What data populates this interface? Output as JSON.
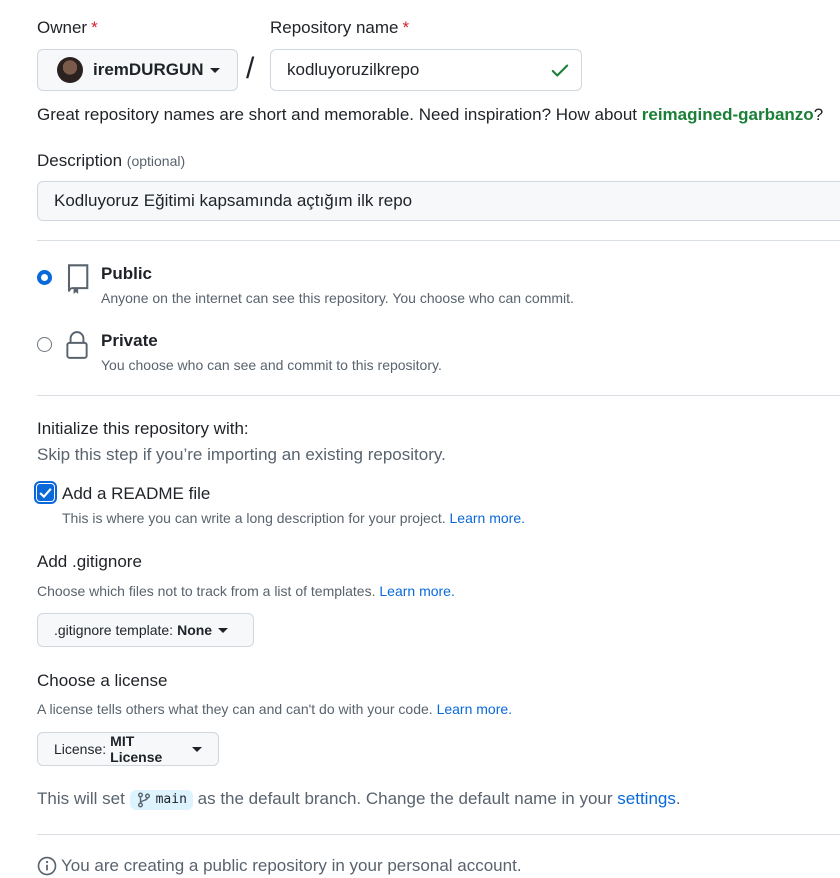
{
  "owner": {
    "label": "Owner",
    "required_mark": "*",
    "name": "iremDURGUN"
  },
  "separator": "/",
  "repository_name": {
    "label": "Repository name",
    "required_mark": "*",
    "value": "kodluyoruzilkrepo"
  },
  "name_hint": {
    "text": "Great repository names are short and memorable. Need inspiration? How about",
    "suggestion": "reimagined-garbanzo",
    "end": "?"
  },
  "description": {
    "label": "Description",
    "optional": "(optional)",
    "value": "Kodluyoruz Eğitimi kapsamında açtığım ilk repo"
  },
  "visibility": {
    "public": {
      "title": "Public",
      "subtitle": "Anyone on the internet can see this repository. You choose who can commit.",
      "selected": true
    },
    "private": {
      "title": "Private",
      "subtitle": "You choose who can see and commit to this repository.",
      "selected": false
    }
  },
  "initialize": {
    "title": "Initialize this repository with:",
    "subtitle": "Skip this step if you’re importing an existing repository.",
    "readme": {
      "label": "Add a README file",
      "description": "This is where you can write a long description for your project.",
      "learn_more": "Learn more.",
      "checked": true
    }
  },
  "gitignore": {
    "title": "Add .gitignore",
    "description": "Choose which files not to track from a list of templates.",
    "learn_more": "Learn more.",
    "button_prefix": ".gitignore template:",
    "button_value": "None"
  },
  "license": {
    "title": "Choose a license",
    "description": "A license tells others what they can and can't do with your code.",
    "learn_more": "Learn more.",
    "button_prefix": "License:",
    "button_value": "MIT License"
  },
  "default_branch": {
    "prefix": "This will set",
    "branch": "main",
    "middle": "as the default branch. Change the default name in your",
    "link": "settings",
    "end": "."
  },
  "notice": "You are creating a public repository in your personal account.",
  "colors": {
    "accent": "#0969da",
    "success": "#1a7f37",
    "danger": "#cf222e"
  }
}
